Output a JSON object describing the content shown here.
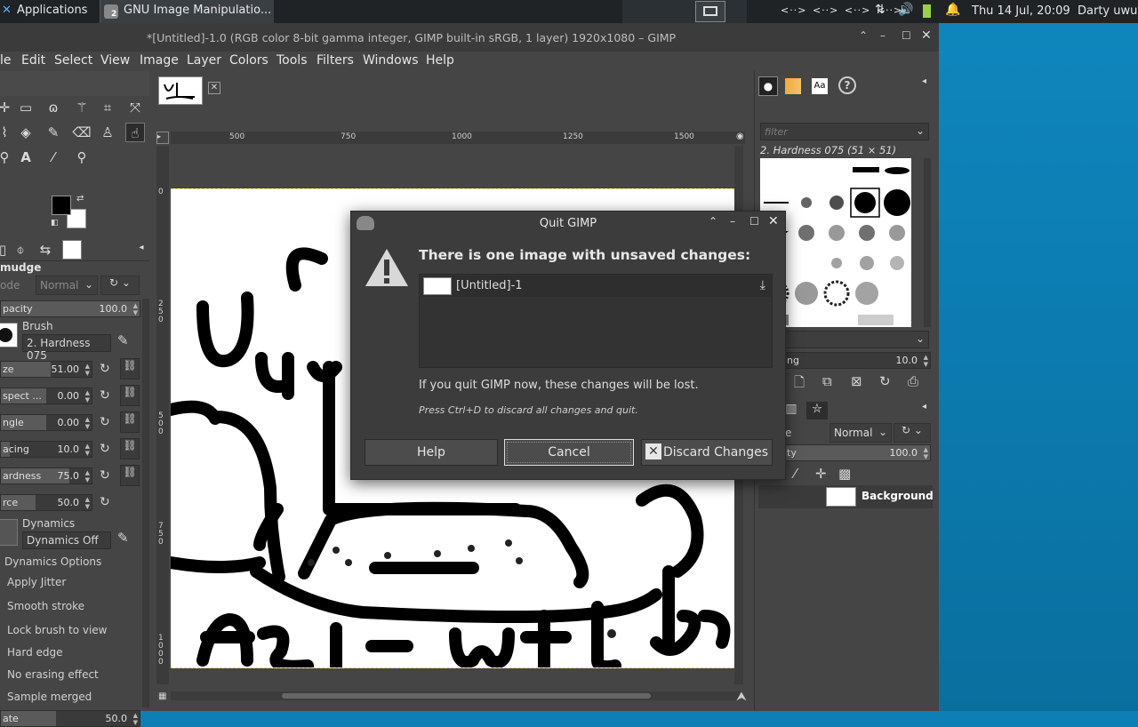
{
  "taskbar": {
    "apps_label": "Applications",
    "window_label": "GNU Image Manipulatio...",
    "window_badge": "2",
    "net_icons": [
      "<··>",
      "<··>",
      "<··>",
      "<··>"
    ],
    "datetime": "Thu 14 Jul, 20:09",
    "user": "Darty uwu"
  },
  "window": {
    "title": "*[Untitled]-1.0 (RGB color 8-bit gamma integer, GIMP built-in sRGB, 1 layer) 1920x1080 – GIMP"
  },
  "menu": [
    "le",
    "Edit",
    "Select",
    "View",
    "Image",
    "Layer",
    "Colors",
    "Tools",
    "Filters",
    "Windows",
    "Help"
  ],
  "tool_options": {
    "tool_name": "mudge",
    "mode_label": "ode",
    "mode_value": "Normal",
    "opacity_label": "pacity",
    "opacity_value": "100.0",
    "brush_label": "Brush",
    "brush_name": "2. Hardness 075",
    "controls": [
      {
        "label": "ze",
        "value": "51.00",
        "fill": 0.55
      },
      {
        "label": "spect ...",
        "value": "0.00",
        "fill": 0.5
      },
      {
        "label": "ngle",
        "value": "0.00",
        "fill": 0.5
      },
      {
        "label": "acing",
        "value": "10.0",
        "fill": 0.1
      },
      {
        "label": "ardness",
        "value": "75.0",
        "fill": 0.75
      }
    ],
    "force_label": "rce",
    "force_value": "50.0",
    "dynamics_label": "Dynamics",
    "dynamics_value": "Dynamics Off",
    "options_header": "Dynamics Options",
    "options": [
      "Apply Jitter",
      "Smooth stroke",
      "Lock brush to view",
      "Hard edge",
      "No erasing effect",
      "Sample merged"
    ],
    "rate_label": "ate",
    "rate_value": "50.0"
  },
  "ruler": {
    "h_ticks": [
      "500",
      "750",
      "1000",
      "1250",
      "1500"
    ],
    "v_ticks": [
      "0",
      "2\n5\n0",
      "5\n0\n0",
      "7\n5\n0",
      "1\n0\n0\n0"
    ]
  },
  "brushes": {
    "filter_placeholder": "filter",
    "brush_title": "2. Hardness 075 (51 × 51)",
    "spacing_label": "ing",
    "spacing_value": "10.0"
  },
  "layers": {
    "mode_label": "e",
    "mode_value": "Normal",
    "opacity_label": "ity",
    "opacity_value": "100.0",
    "layer_name": "Background"
  },
  "dialog": {
    "title": "Quit GIMP",
    "heading": "There is one image with unsaved changes:",
    "image_name": "[Untitled]-1",
    "warning": "If you quit GIMP now, these changes will be lost.",
    "hint": "Press Ctrl+D to discard all changes and quit.",
    "help_label": "Help",
    "cancel_label": "Cancel",
    "discard_label": "Discard Changes"
  },
  "colors": {
    "accent": "#0d7fb5",
    "dialog_bg": "#3c3c3c",
    "canvas_bg": "#ffffff"
  }
}
